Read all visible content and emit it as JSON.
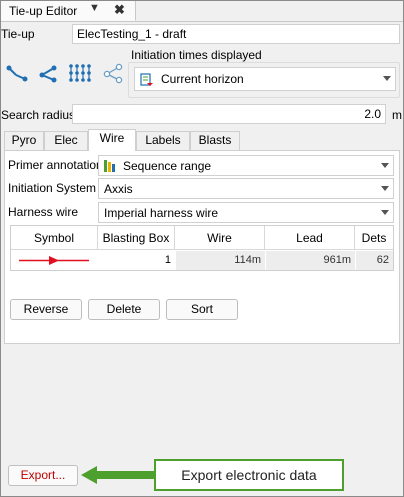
{
  "window": {
    "title": "Tie-up Editor",
    "menu_glyph": "▼",
    "close_glyph": "✖"
  },
  "tieup": {
    "label": "Tie-up",
    "value": "ElecTesting_1 - draft"
  },
  "initiation": {
    "group_label": "Initiation times displayed",
    "selected": "Current horizon"
  },
  "toolbar": {
    "icons": [
      "connect-tool",
      "branch-tool",
      "grid-tool",
      "share-tool"
    ]
  },
  "search": {
    "label": "Search radius",
    "value": "2.0",
    "unit": "m"
  },
  "tabs": [
    {
      "label": "Pyro",
      "active": false
    },
    {
      "label": "Elec",
      "active": false
    },
    {
      "label": "Wire",
      "active": true
    },
    {
      "label": "Labels",
      "active": false
    },
    {
      "label": "Blasts",
      "active": false
    }
  ],
  "wire_tab": {
    "primer_annotation": {
      "label": "Primer annotation",
      "value": "Sequence range"
    },
    "initiation_system": {
      "label": "Initiation System",
      "value": "Axxis"
    },
    "harness_wire": {
      "label": "Harness wire",
      "value": "Imperial harness wire"
    },
    "table": {
      "columns": [
        "Symbol",
        "Blasting Box",
        "Wire",
        "Lead",
        "Dets"
      ],
      "rows": [
        {
          "symbol_color": "#e01020",
          "blasting_box": "1",
          "wire": "114m",
          "lead": "961m",
          "dets": "62"
        }
      ]
    },
    "buttons": {
      "reverse": "Reverse",
      "delete": "Delete",
      "sort": "Sort"
    }
  },
  "export": {
    "button_label": "Export...",
    "callout": "Export electronic data"
  },
  "colors": {
    "accent_blue": "#1f6fb2",
    "callout_green": "#4da02e",
    "export_red": "#c00000"
  }
}
